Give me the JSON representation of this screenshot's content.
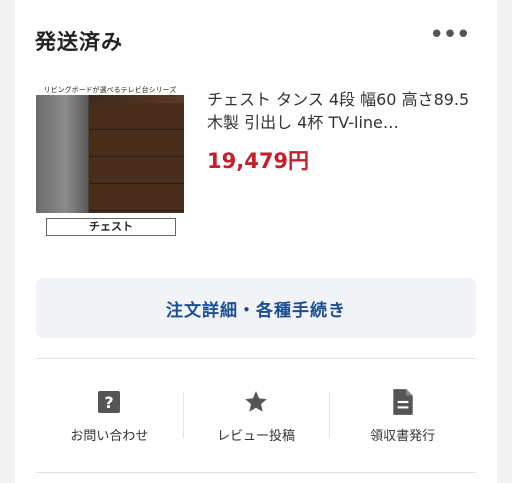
{
  "order": {
    "status": "発送済み",
    "more_icon": "more-horizontal-icon"
  },
  "product": {
    "image_banner": "リビングボードが選べるテレビ台シリーズ",
    "image_label": "チェスト",
    "title": "チェスト タンス 4段 幅60 高さ89.5 木製 引出し 4杯 TV-line…",
    "price": "19,479円"
  },
  "detail_button": {
    "label": "注文詳細・各種手続き"
  },
  "actions": [
    {
      "icon": "question-icon",
      "label": "お問い合わせ"
    },
    {
      "icon": "star-icon",
      "label": "レビュー投稿"
    },
    {
      "icon": "document-icon",
      "label": "領収書発行"
    }
  ],
  "colors": {
    "price": "#c31f2c",
    "link": "#1a4f96"
  }
}
